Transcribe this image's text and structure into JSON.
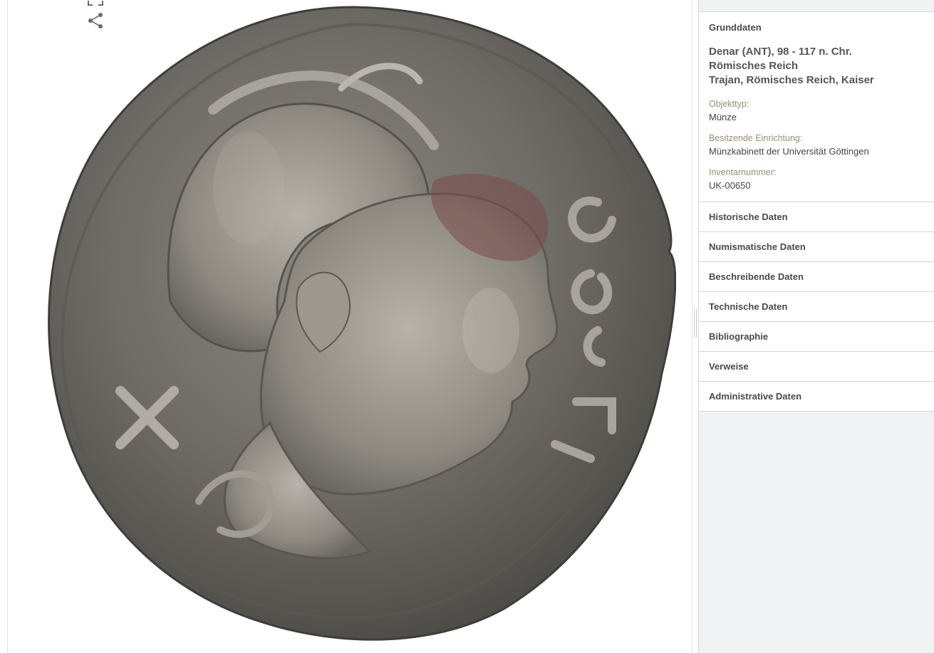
{
  "viewer": {
    "fullscreen_icon": "fullscreen-icon",
    "share_icon": "share-icon",
    "image": "coin-obverse"
  },
  "panel": {
    "sections": [
      {
        "label": "Grunddaten",
        "open": true,
        "title_lines": [
          "Denar (ANT), 98 - 117 n. Chr.",
          "Römisches Reich",
          "Trajan, Römisches Reich, Kaiser"
        ],
        "fields": [
          {
            "label": "Objekttyp:",
            "value": "Münze"
          },
          {
            "label": "Besitzende Einrichtung:",
            "value": "Münzkabinett der Universität Göttingen"
          },
          {
            "label": "Inventarnummer:",
            "value": "UK-00650"
          }
        ]
      },
      {
        "label": "Historische Daten",
        "open": false
      },
      {
        "label": "Numismatische Daten",
        "open": false
      },
      {
        "label": "Beschreibende Daten",
        "open": false
      },
      {
        "label": "Technische Daten",
        "open": false
      },
      {
        "label": "Bibliographie",
        "open": false
      },
      {
        "label": "Verweise",
        "open": false
      },
      {
        "label": "Administrative Daten",
        "open": false
      }
    ]
  },
  "colors": {
    "label": "#9a8f70",
    "heading": "#4a4a4a",
    "panel_bg": "#f1f2f3"
  }
}
